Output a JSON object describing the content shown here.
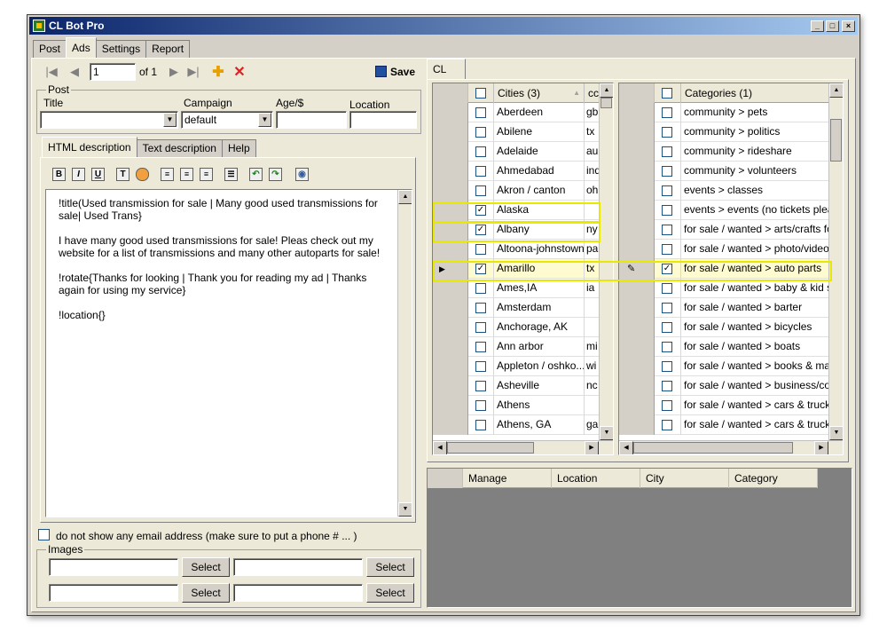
{
  "window": {
    "title": "CL Bot Pro",
    "controls": {
      "minimize": "_",
      "maximize": "□",
      "close": "×"
    }
  },
  "main_tabs": [
    "Post",
    "Ads",
    "Settings",
    "Report"
  ],
  "toolbar": {
    "record_value": "1",
    "record_total": "of 1",
    "save_label": "Save"
  },
  "post_group": {
    "legend": "Post",
    "title_label": "Title",
    "campaign_label": "Campaign",
    "campaign_value": "default",
    "age_label": "Age/$",
    "location_label": "Location",
    "title_value": "",
    "age_value": "",
    "location_value": ""
  },
  "desc_tabs": [
    "HTML description",
    "Text description",
    "Help"
  ],
  "editor": {
    "paragraphs": [
      "!title(Used transmission for sale | Many good used transmissions for sale| Used Trans}",
      "I have many good used transmissions for sale! Pleas check out my website for a list of transmissions and many other autoparts for sale!",
      "!rotate{Thanks for looking | Thank you for reading my ad | Thanks again for using my service}",
      "!location{}"
    ]
  },
  "email_option": "do not show any email address (make sure to put a phone # ... )",
  "images": {
    "legend": "Images",
    "select_label": "Select"
  },
  "cl_tab": "CL",
  "cities_grid": {
    "header_cities": "Cities (3)",
    "header_code": "cc",
    "rows": [
      {
        "name": "Aberdeen",
        "code": "gb",
        "checked": false
      },
      {
        "name": "Abilene",
        "code": "tx",
        "checked": false
      },
      {
        "name": "Adelaide",
        "code": "au",
        "checked": false
      },
      {
        "name": "Ahmedabad",
        "code": "ind",
        "checked": false
      },
      {
        "name": "Akron / canton",
        "code": "oh",
        "checked": false
      },
      {
        "name": "Alaska",
        "code": "",
        "checked": true
      },
      {
        "name": "Albany",
        "code": "ny",
        "checked": true
      },
      {
        "name": "Altoona-johnstown",
        "code": "pa",
        "checked": false
      },
      {
        "name": "Amarillo",
        "code": "tx",
        "checked": true
      },
      {
        "name": "Ames,IA",
        "code": "ia",
        "checked": false
      },
      {
        "name": "Amsterdam",
        "code": "",
        "checked": false
      },
      {
        "name": "Anchorage, AK",
        "code": "",
        "checked": false
      },
      {
        "name": "Ann arbor",
        "code": "mi",
        "checked": false
      },
      {
        "name": "Appleton / oshko...",
        "code": "wi",
        "checked": false
      },
      {
        "name": "Asheville",
        "code": "nc",
        "checked": false
      },
      {
        "name": "Athens",
        "code": "",
        "checked": false
      },
      {
        "name": "Athens, GA",
        "code": "ga",
        "checked": false
      }
    ]
  },
  "categories_grid": {
    "header": "Categories (1)",
    "rows": [
      {
        "name": "community > pets",
        "checked": false
      },
      {
        "name": "community > politics",
        "checked": false
      },
      {
        "name": "community > rideshare",
        "checked": false
      },
      {
        "name": "community > volunteers",
        "checked": false
      },
      {
        "name": "events > classes",
        "checked": false
      },
      {
        "name": "events > events (no tickets please!",
        "checked": false
      },
      {
        "name": "for sale / wanted >  arts/crafts for s",
        "checked": false
      },
      {
        "name": "for sale / wanted >  photo/video fc",
        "checked": false
      },
      {
        "name": "for sale / wanted > auto parts",
        "checked": true
      },
      {
        "name": "for sale / wanted > baby & kid stuff",
        "checked": false
      },
      {
        "name": "for sale / wanted > barter",
        "checked": false
      },
      {
        "name": "for sale / wanted > bicycles",
        "checked": false
      },
      {
        "name": "for sale / wanted > boats",
        "checked": false
      },
      {
        "name": "for sale / wanted > books & magaz",
        "checked": false
      },
      {
        "name": "for sale / wanted > business/comm",
        "checked": false
      },
      {
        "name": "for sale / wanted > cars & trucks - l",
        "checked": false
      },
      {
        "name": "for sale / wanted > cars & trucks - l",
        "checked": false
      }
    ]
  },
  "manage_grid": {
    "columns": [
      "Manage",
      "Location",
      "City",
      "Category"
    ]
  },
  "colors": {
    "titlebar_start": "#0a246a",
    "titlebar_end": "#a6caf0",
    "highlight": "#e8e800",
    "selected_row": "#fffbd0",
    "empty_grid": "#808080"
  }
}
